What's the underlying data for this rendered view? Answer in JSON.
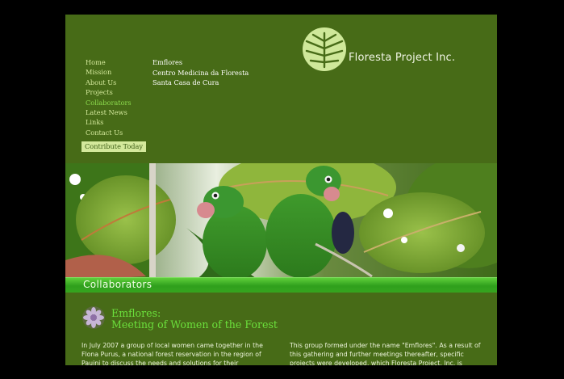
{
  "nav": {
    "items": [
      {
        "label": "Home"
      },
      {
        "label": "Mission"
      },
      {
        "label": "About Us"
      },
      {
        "label": "Projects"
      },
      {
        "label": "Collaborators"
      },
      {
        "label": "Latest News"
      },
      {
        "label": "Links"
      },
      {
        "label": "Contact Us"
      }
    ],
    "contribute_label": "Contribute Today"
  },
  "subnav": {
    "items": [
      {
        "label": "Emflores"
      },
      {
        "label": "Centro Medicina da Floresta"
      },
      {
        "label": "Santa Casa de Cura"
      }
    ]
  },
  "logo": {
    "text": "Floresta Project Inc.",
    "icon": "leaf-icon"
  },
  "banner": {
    "icon": "parrots-photo"
  },
  "section": {
    "title": "Collaborators"
  },
  "article": {
    "icon": "flower-icon",
    "heading_line1": "Emflores:",
    "heading_line2": "Meeting of Women of the Forest",
    "col1": "In July 2007 a group of local women came together in the Flona Purus, a national forest reservation in the region of Pauini to discuss the needs and solutions for their",
    "col2": "This group formed under the name \"Emflores\". As a result of this gathering and further meetings thereafter, specific projects were developed, which Floresta Project, Inc. is"
  },
  "colors": {
    "page_bg": "#000000",
    "site_bg": "#476b17",
    "nav_text": "#d4e99c",
    "active_nav": "#8ddc4e",
    "heading": "#6be03c",
    "section_bar": "#36a51f"
  }
}
